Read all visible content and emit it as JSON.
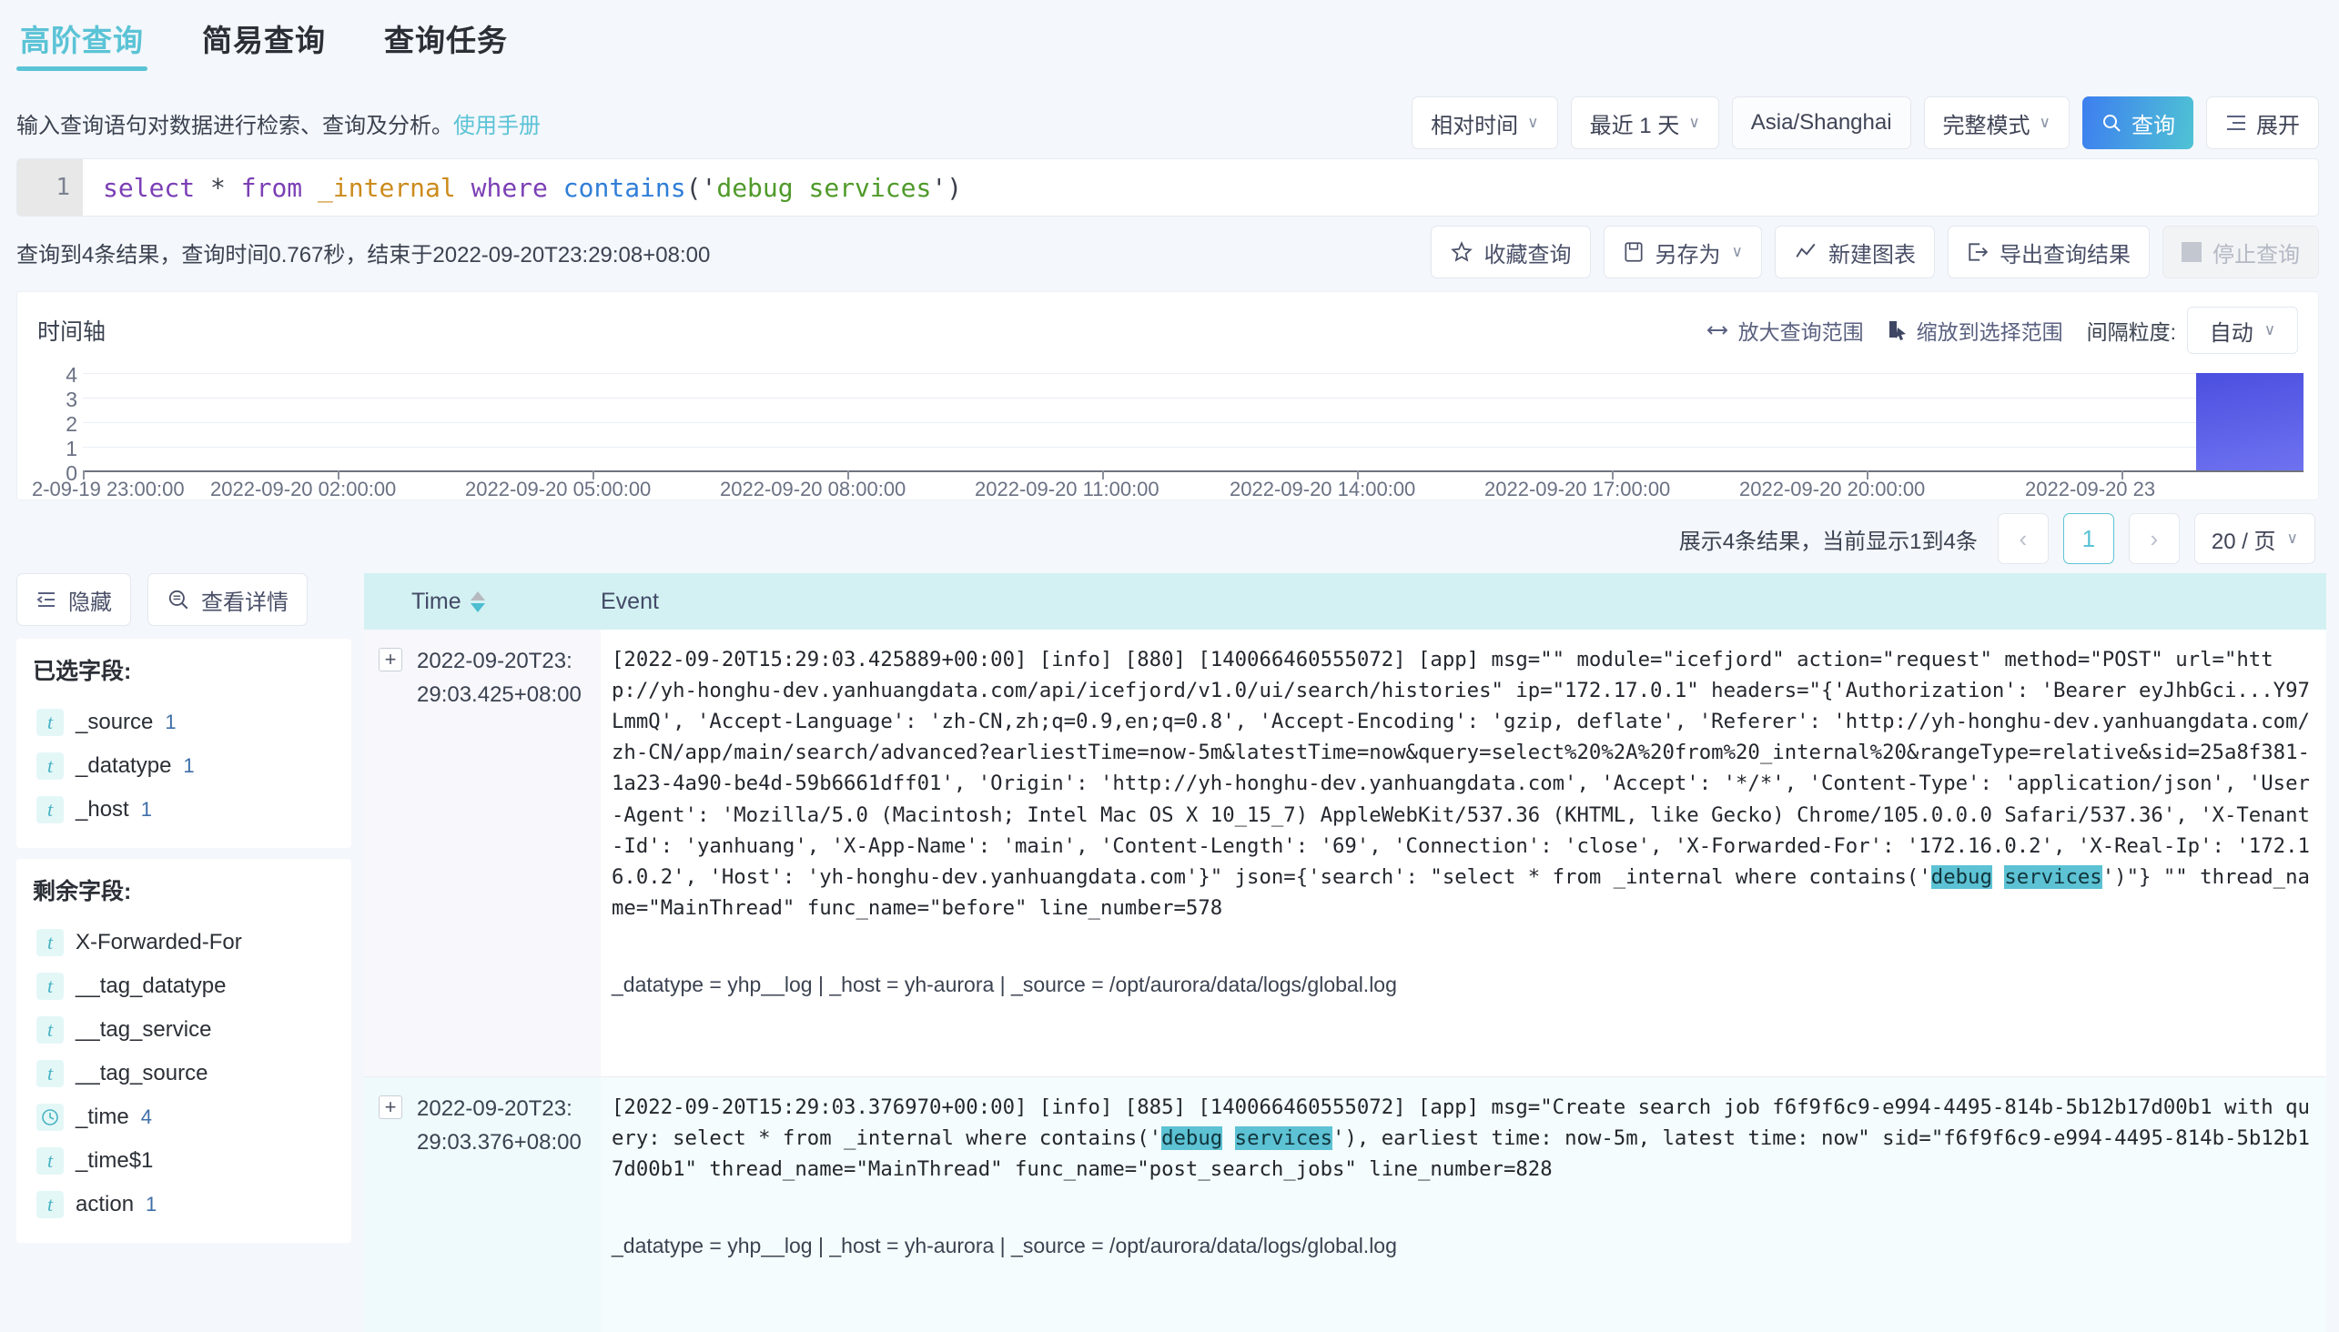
{
  "tabs": [
    {
      "label": "高阶查询",
      "active": true
    },
    {
      "label": "简易查询",
      "active": false
    },
    {
      "label": "查询任务",
      "active": false
    }
  ],
  "subtitle": {
    "text": "输入查询语句对数据进行检索、查询及分析。",
    "link": "使用手册"
  },
  "toolbar": {
    "time_mode": "相对时间",
    "time_range": "最近 1 天",
    "timezone": "Asia/Shanghai",
    "query_mode": "完整模式",
    "search_button": "查询",
    "expand_button": "展开",
    "caret": "∨"
  },
  "editor": {
    "line_number": "1",
    "tokens": {
      "select": "select",
      "star": " * ",
      "from": "from",
      "table": " _internal ",
      "where": "where",
      "space": " ",
      "fn": "contains",
      "open": "('",
      "string": "debug services",
      "close": "')"
    },
    "full_query": "select * from _internal where contains('debug services')"
  },
  "result_bar": {
    "summary": "查询到4条结果，查询时间0.767秒，结束于2022-09-20T23:29:08+08:00",
    "actions": [
      {
        "label": "收藏查询",
        "icon": "star-icon",
        "disabled": false,
        "caret": ""
      },
      {
        "label": "另存为",
        "icon": "save-icon",
        "disabled": false,
        "caret": "∨"
      },
      {
        "label": "新建图表",
        "icon": "chart-icon",
        "disabled": false,
        "caret": ""
      },
      {
        "label": "导出查询结果",
        "icon": "export-icon",
        "disabled": false,
        "caret": ""
      },
      {
        "label": "停止查询",
        "icon": "stop-icon",
        "disabled": true,
        "caret": ""
      }
    ]
  },
  "timeline": {
    "title": "时间轴",
    "zoom_out_label": "放大查询范围",
    "zoom_selection_label": "缩放到选择范围",
    "granularity_label": "间隔粒度:",
    "granularity_value": "自动",
    "caret": "∨"
  },
  "chart_data": {
    "type": "bar",
    "title": "时间轴",
    "xlabel": "",
    "ylabel": "",
    "ylim": [
      0,
      4
    ],
    "yticks": [
      "4",
      "3",
      "2",
      "1",
      "0"
    ],
    "grid": true,
    "legend": "none",
    "categories": [
      "2022-09-19 23:00:00",
      "2022-09-20 02:00:00",
      "2022-09-20 05:00:00",
      "2022-09-20 08:00:00",
      "2022-09-20 11:00:00",
      "2022-09-20 14:00:00",
      "2022-09-20 17:00:00",
      "2022-09-20 20:00:00",
      "2022-09-20 23"
    ],
    "xtick_labels": [
      "2-09-19 23:00:00",
      "2022-09-20 02:00:00",
      "2022-09-20 05:00:00",
      "2022-09-20 08:00:00",
      "2022-09-20 11:00:00",
      "2022-09-20 14:00:00",
      "2022-09-20 17:00:00",
      "2022-09-20 20:00:00",
      "2022-09-20 23"
    ],
    "values": [
      0,
      0,
      0,
      0,
      0,
      0,
      0,
      0,
      4
    ],
    "bar_color": "#5b5fe8"
  },
  "pagination": {
    "summary": "展示4条结果，当前显示1到4条",
    "prev": "‹",
    "current_page": "1",
    "next": "›",
    "page_size": "20 / 页",
    "caret": "∨"
  },
  "sidebar": {
    "hide_button": "隐藏",
    "detail_button": "查看详情",
    "selected_title": "已选字段:",
    "selected_fields": [
      {
        "name": "_source",
        "count": "1",
        "type": "t"
      },
      {
        "name": "_datatype",
        "count": "1",
        "type": "t"
      },
      {
        "name": "_host",
        "count": "1",
        "type": "t"
      }
    ],
    "remaining_title": "剩余字段:",
    "remaining_fields": [
      {
        "name": "X-Forwarded-For",
        "count": "",
        "type": "t"
      },
      {
        "name": "__tag_datatype",
        "count": "",
        "type": "t"
      },
      {
        "name": "__tag_service",
        "count": "",
        "type": "t"
      },
      {
        "name": "__tag_source",
        "count": "",
        "type": "t"
      },
      {
        "name": "_time",
        "count": "4",
        "type": "clock"
      },
      {
        "name": "_time$1",
        "count": "",
        "type": "t"
      },
      {
        "name": "action",
        "count": "1",
        "type": "t"
      }
    ]
  },
  "table": {
    "columns": {
      "expand": "",
      "time": "Time",
      "event": "Event"
    },
    "rows": [
      {
        "time": "2022-09-20T23:29:03.425+08:00",
        "expand": "+",
        "event_pre": "[2022-09-20T15:29:03.425889+00:00] [info] [880] [140066460555072] [app] msg=\"\" module=\"icefjord\" action=\"request\" method=\"POST\" url=\"http://yh-honghu-dev.yanhuangdata.com/api/icefjord/v1.0/ui/search/histories\" ip=\"172.17.0.1\" headers=\"{'Authorization': 'Bearer eyJhbGci...Y97LmmQ', 'Accept-Language': 'zh-CN,zh;q=0.9,en;q=0.8', 'Accept-Encoding': 'gzip, deflate', 'Referer': 'http://yh-honghu-dev.yanhuangdata.com/zh-CN/app/main/search/advanced?earliestTime=now-5m&latestTime=now&query=select%20%2A%20from%20_internal%20&rangeType=relative&sid=25a8f381-1a23-4a90-be4d-59b6661dff01', 'Origin': 'http://yh-honghu-dev.yanhuangdata.com', 'Accept': '*/*', 'Content-Type': 'application/json', 'User-Agent': 'Mozilla/5.0 (Macintosh; Intel Mac OS X 10_15_7) AppleWebKit/537.36 (KHTML, like Gecko) Chrome/105.0.0.0 Safari/537.36', 'X-Tenant-Id': 'yanhuang', 'X-App-Name': 'main', 'Content-Length': '69', 'Connection': 'close', 'X-Forwarded-For': '172.16.0.2', 'X-Real-Ip': '172.16.0.2', 'Host': 'yh-honghu-dev.yanhuangdata.com'}\" json={'search': \"select * from _internal where contains('",
        "hl1": "debug",
        "event_mid": " ",
        "hl2": "services",
        "event_post": "')\"} \"\" thread_name=\"MainThread\" func_name=\"before\" line_number=578",
        "meta": "_datatype = yhp__log | _host = yh-aurora | _source = /opt/aurora/data/logs/global.log"
      },
      {
        "time": "2022-09-20T23:29:03.376+08:00",
        "expand": "+",
        "event_pre": "[2022-09-20T15:29:03.376970+00:00] [info] [885] [140066460555072] [app] msg=\"Create search job f6f9f6c9-e994-4495-814b-5b12b17d00b1 with query: select * from _internal where contains('",
        "hl1": "debug",
        "event_mid": " ",
        "hl2": "services",
        "event_post": "'), earliest time: now-5m, latest time: now\" sid=\"f6f9f6c9-e994-4495-814b-5b12b17d00b1\" thread_name=\"MainThread\" func_name=\"post_search_jobs\" line_number=828",
        "meta": "_datatype = yhp__log | _host = yh-aurora | _source = /opt/aurora/data/logs/global.log"
      }
    ]
  }
}
